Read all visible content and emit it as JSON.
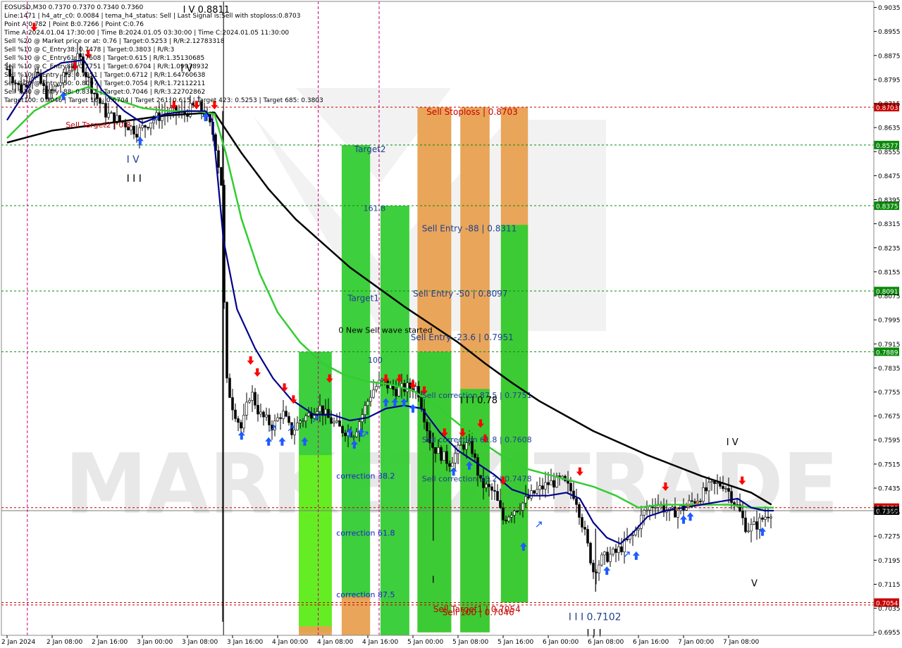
{
  "header": {
    "lines": [
      "EOSUSD,M30  0.7370 0.7370 0.7340 0.7360",
      "Line:1471  |  h4_atr_c0: 0.0084 |  tema_h4_status: Sell  |  Last Signal is:Sell with stoploss:0.8703",
      "Point A:0.782  |  Point B:0.7266  |  Point C:0.76",
      "Time A:2024.01.04 17:30:00  |  Time B:2024.01.05 03:30:00  |  Time C:2024.01.05 11:30:00",
      "Sell %20 @ Market price or at: 0.76  |  Target:0.5253  |  R/R:2.12783318",
      "Sell %10 @ C_Entry38: 0.7478  |  Target:0.3803  |  R/R:3",
      "Sell %10 @ C_Entry61: 0.7608  |  Target:0.615  |  R/R:1.35130685",
      "Sell %10 @ C_Entry88: 0.7751  |  Target:0.6704  |  R/R:1.09978932",
      "Sell %10 @ Entry -23: 0.7951  |  Target:0.6712  |  R/R:1.64760638",
      "Sell %20 @ Entry -50: 0.8097  |  Target:0.7054  |  R/R:1.72112211",
      "Sell %20 @ Entry -88: 0.8311  |  Target:0.7046  |  R/R:3.22702862",
      "Target100: 0.7046  |  Target 161: 0.6704  |  Target 261: 0.615  |  Target 423: 0.5253  |  Target 685: 0.3803"
    ]
  },
  "watermark": "MARKETZITRADE",
  "colors": {
    "background": "#ffffff",
    "bull_candle": "#000000",
    "bear_candle": "#000000",
    "ma_fast": "#00008b",
    "ma_mid": "#32cd32",
    "ma_slow": "#000000",
    "level_green": "#0a8a0a",
    "level_red": "#c80000",
    "price_line": "#d00000",
    "zone_green": "#33cc33",
    "zone_lime": "#66ee22",
    "zone_orange": "#e8a050",
    "arrow_red": "#ff0000",
    "arrow_blue": "#1e5aff",
    "vline_magenta": "#cc0077"
  },
  "chart_data": {
    "type": "candlestick",
    "symbol": "EOSUSD",
    "timeframe": "M30",
    "ohlc_last": {
      "open": 0.737,
      "high": 0.737,
      "low": 0.734,
      "close": 0.736
    },
    "ylim": [
      0.6945,
      0.9055
    ],
    "yticks": [
      "0.9035",
      "0.8955",
      "0.8875",
      "0.8795",
      "0.8715",
      "0.8635",
      "0.8555",
      "0.8475",
      "0.8395",
      "0.8315",
      "0.8235",
      "0.8155",
      "0.8075",
      "0.7995",
      "0.7915",
      "0.7835",
      "0.7755",
      "0.7675",
      "0.7595",
      "0.7515",
      "0.7435",
      "0.7355",
      "0.7275",
      "0.7195",
      "0.7115",
      "0.7035",
      "0.6955"
    ],
    "xticks": [
      "2 Jan 2024",
      "2 Jan 08:00",
      "2 Jan 16:00",
      "3 Jan 00:00",
      "3 Jan 08:00",
      "3 Jan 16:00",
      "4 Jan 00:00",
      "4 Jan 08:00",
      "4 Jan 16:00",
      "5 Jan 00:00",
      "5 Jan 08:00",
      "5 Jan 16:00",
      "6 Jan 00:00",
      "6 Jan 08:00",
      "6 Jan 16:00",
      "7 Jan 00:00",
      "7 Jan 08:00"
    ],
    "xmax_index": 17.1,
    "price_key_points": [
      [
        0,
        0.883
      ],
      [
        0.3,
        0.876
      ],
      [
        0.6,
        0.882
      ],
      [
        0.9,
        0.874
      ],
      [
        1.2,
        0.879
      ],
      [
        1.6,
        0.887
      ],
      [
        1.9,
        0.876
      ],
      [
        2.2,
        0.868
      ],
      [
        2.6,
        0.865
      ],
      [
        2.9,
        0.862
      ],
      [
        3.2,
        0.866
      ],
      [
        3.6,
        0.869
      ],
      [
        3.9,
        0.868
      ],
      [
        4.2,
        0.871
      ],
      [
        4.4,
        0.868
      ],
      [
        4.6,
        0.86
      ],
      [
        4.75,
        0.845
      ],
      [
        4.85,
        0.78
      ],
      [
        5.0,
        0.771
      ],
      [
        5.2,
        0.763
      ],
      [
        5.4,
        0.776
      ],
      [
        5.6,
        0.768
      ],
      [
        5.9,
        0.764
      ],
      [
        6.1,
        0.769
      ],
      [
        6.3,
        0.762
      ],
      [
        6.5,
        0.766
      ],
      [
        6.7,
        0.768
      ],
      [
        6.9,
        0.771
      ],
      [
        7.1,
        0.767
      ],
      [
        7.4,
        0.763
      ],
      [
        7.7,
        0.762
      ],
      [
        7.9,
        0.769
      ],
      [
        8.1,
        0.776
      ],
      [
        8.3,
        0.779
      ],
      [
        8.6,
        0.776
      ],
      [
        8.9,
        0.777
      ],
      [
        9.1,
        0.777
      ],
      [
        9.4,
        0.758
      ],
      [
        9.6,
        0.755
      ],
      [
        9.8,
        0.752
      ],
      [
        10.1,
        0.758
      ],
      [
        10.3,
        0.757
      ],
      [
        10.5,
        0.745
      ],
      [
        10.8,
        0.742
      ],
      [
        11.0,
        0.733
      ],
      [
        11.2,
        0.736
      ],
      [
        11.4,
        0.738
      ],
      [
        11.7,
        0.742
      ],
      [
        12.0,
        0.745
      ],
      [
        12.3,
        0.746
      ],
      [
        12.6,
        0.741
      ],
      [
        12.8,
        0.729
      ],
      [
        13.0,
        0.716
      ],
      [
        13.2,
        0.72
      ],
      [
        13.5,
        0.722
      ],
      [
        13.7,
        0.725
      ],
      [
        13.9,
        0.728
      ],
      [
        14.1,
        0.735
      ],
      [
        14.4,
        0.739
      ],
      [
        14.7,
        0.735
      ],
      [
        15.0,
        0.737
      ],
      [
        15.3,
        0.74
      ],
      [
        15.6,
        0.744
      ],
      [
        15.9,
        0.745
      ],
      [
        16.2,
        0.737
      ],
      [
        16.4,
        0.73
      ],
      [
        16.6,
        0.731
      ],
      [
        16.8,
        0.734
      ],
      [
        16.95,
        0.736
      ]
    ],
    "ma_fast": [
      [
        0,
        0.866
      ],
      [
        0.6,
        0.88
      ],
      [
        1.2,
        0.885
      ],
      [
        1.7,
        0.886
      ],
      [
        2.1,
        0.876
      ],
      [
        2.6,
        0.869
      ],
      [
        3.0,
        0.865
      ],
      [
        3.5,
        0.868
      ],
      [
        4.0,
        0.869
      ],
      [
        4.4,
        0.869
      ],
      [
        4.55,
        0.866
      ],
      [
        4.8,
        0.826
      ],
      [
        5.1,
        0.803
      ],
      [
        5.5,
        0.79
      ],
      [
        5.9,
        0.78
      ],
      [
        6.3,
        0.773
      ],
      [
        6.8,
        0.768
      ],
      [
        7.2,
        0.768
      ],
      [
        7.6,
        0.766
      ],
      [
        8.0,
        0.767
      ],
      [
        8.4,
        0.77
      ],
      [
        8.8,
        0.771
      ],
      [
        9.2,
        0.77
      ],
      [
        9.6,
        0.762
      ],
      [
        10.0,
        0.756
      ],
      [
        10.4,
        0.752
      ],
      [
        10.8,
        0.748
      ],
      [
        11.2,
        0.743
      ],
      [
        11.6,
        0.741
      ],
      [
        12.0,
        0.741
      ],
      [
        12.4,
        0.742
      ],
      [
        12.7,
        0.74
      ],
      [
        13.0,
        0.732
      ],
      [
        13.3,
        0.727
      ],
      [
        13.6,
        0.725
      ],
      [
        13.9,
        0.729
      ],
      [
        14.2,
        0.734
      ],
      [
        14.6,
        0.736
      ],
      [
        15.0,
        0.737
      ],
      [
        15.4,
        0.738
      ],
      [
        15.8,
        0.739
      ],
      [
        16.2,
        0.74
      ],
      [
        16.5,
        0.737
      ],
      [
        16.8,
        0.736
      ],
      [
        17.0,
        0.736
      ]
    ],
    "ma_mid": [
      [
        0,
        0.86
      ],
      [
        0.6,
        0.869
      ],
      [
        1.2,
        0.874
      ],
      [
        1.8,
        0.877
      ],
      [
        2.4,
        0.873
      ],
      [
        3.0,
        0.87
      ],
      [
        3.6,
        0.869
      ],
      [
        4.2,
        0.869
      ],
      [
        4.6,
        0.868
      ],
      [
        4.85,
        0.855
      ],
      [
        5.2,
        0.833
      ],
      [
        5.6,
        0.815
      ],
      [
        6.0,
        0.802
      ],
      [
        6.5,
        0.792
      ],
      [
        7.0,
        0.785
      ],
      [
        7.5,
        0.781
      ],
      [
        8.0,
        0.779
      ],
      [
        8.5,
        0.778
      ],
      [
        9.0,
        0.776
      ],
      [
        9.5,
        0.771
      ],
      [
        10.0,
        0.765
      ],
      [
        10.5,
        0.759
      ],
      [
        11.0,
        0.754
      ],
      [
        11.5,
        0.75
      ],
      [
        12.0,
        0.748
      ],
      [
        12.5,
        0.746
      ],
      [
        13.0,
        0.744
      ],
      [
        13.5,
        0.741
      ],
      [
        14.0,
        0.737
      ],
      [
        14.5,
        0.738
      ],
      [
        15.0,
        0.738
      ],
      [
        15.5,
        0.738
      ],
      [
        16.0,
        0.738
      ],
      [
        16.5,
        0.737
      ],
      [
        17.0,
        0.737
      ]
    ],
    "ma_slow": [
      [
        0,
        0.8585
      ],
      [
        0.5,
        0.8605
      ],
      [
        1.0,
        0.8625
      ],
      [
        1.5,
        0.8635
      ],
      [
        2.0,
        0.8645
      ],
      [
        2.5,
        0.8655
      ],
      [
        3.0,
        0.8665
      ],
      [
        3.5,
        0.8675
      ],
      [
        4.0,
        0.868
      ],
      [
        4.6,
        0.8685
      ],
      [
        5.2,
        0.855
      ],
      [
        5.8,
        0.843
      ],
      [
        6.4,
        0.833
      ],
      [
        7.0,
        0.825
      ],
      [
        7.6,
        0.817
      ],
      [
        8.2,
        0.8105
      ],
      [
        8.8,
        0.804
      ],
      [
        9.4,
        0.798
      ],
      [
        10.0,
        0.792
      ],
      [
        10.6,
        0.785
      ],
      [
        11.2,
        0.7785
      ],
      [
        11.8,
        0.7725
      ],
      [
        12.4,
        0.7675
      ],
      [
        13.0,
        0.7625
      ],
      [
        13.6,
        0.7585
      ],
      [
        14.2,
        0.7545
      ],
      [
        14.8,
        0.751
      ],
      [
        15.4,
        0.7475
      ],
      [
        16.0,
        0.7445
      ],
      [
        16.5,
        0.742
      ],
      [
        16.95,
        0.738
      ]
    ],
    "current_price": 0.736,
    "levels": [
      {
        "price": 0.8703,
        "label": "0.8703",
        "color": "#c80000",
        "text": "Sell Stoploss | 0.8703"
      },
      {
        "price": 0.8577,
        "label": "0.8577",
        "color": "#0a8a0a"
      },
      {
        "price": 0.8375,
        "label": "0.8375",
        "color": "#0a8a0a"
      },
      {
        "price": 0.8091,
        "label": "0.8091",
        "color": "#0a8a0a"
      },
      {
        "price": 0.7889,
        "label": "0.7889",
        "color": "#0a8a0a"
      },
      {
        "price": 0.737,
        "label": "0.7370",
        "color": "#c80000"
      },
      {
        "price": 0.7054,
        "label": "0.7054",
        "color": "#c80000"
      }
    ],
    "zones": [
      {
        "x0": 6.47,
        "x1": 7.2,
        "y0": 0.6955,
        "y1": 0.7889,
        "color": "green"
      },
      {
        "x0": 6.47,
        "x1": 7.2,
        "y0": 0.6955,
        "y1": 0.7545,
        "color": "lime"
      },
      {
        "x0": 6.47,
        "x1": 7.2,
        "y0": 0.6945,
        "y1": 0.6975,
        "color": "orange"
      },
      {
        "x0": 7.42,
        "x1": 8.05,
        "y0": 0.7065,
        "y1": 0.8577,
        "color": "green"
      },
      {
        "x0": 7.42,
        "x1": 8.05,
        "y0": 0.6945,
        "y1": 0.7075,
        "color": "orange"
      },
      {
        "x0": 8.28,
        "x1": 8.92,
        "y0": 0.6945,
        "y1": 0.8375,
        "color": "green"
      },
      {
        "x0": 9.1,
        "x1": 9.85,
        "y0": 0.6955,
        "y1": 0.8703,
        "color": "orange"
      },
      {
        "x0": 9.1,
        "x1": 9.85,
        "y0": 0.6955,
        "y1": 0.7889,
        "color": "green"
      },
      {
        "x0": 10.05,
        "x1": 10.7,
        "y0": 0.6955,
        "y1": 0.8703,
        "color": "orange"
      },
      {
        "x0": 10.05,
        "x1": 10.7,
        "y0": 0.6955,
        "y1": 0.7765,
        "color": "green"
      },
      {
        "x0": 10.95,
        "x1": 11.55,
        "y0": 0.7054,
        "y1": 0.8703,
        "color": "orange"
      },
      {
        "x0": 10.95,
        "x1": 11.55,
        "y0": 0.7054,
        "y1": 0.8311,
        "color": "green"
      }
    ],
    "vlines": [
      {
        "x": 0.45,
        "color": "magenta"
      },
      {
        "x": 6.9,
        "color": "magenta"
      },
      {
        "x": 8.25,
        "color": "magenta"
      },
      {
        "x": 4.8,
        "color": "black"
      }
    ],
    "annotations": [
      {
        "text": "Target2",
        "x": 7.7,
        "y": 0.8553,
        "color": "#1f3f8f",
        "size": 12
      },
      {
        "text": "161.8",
        "x": 7.9,
        "y": 0.8358,
        "color": "#1f3f8f",
        "size": 11
      },
      {
        "text": "Target1",
        "x": 7.55,
        "y": 0.8058,
        "color": "#1f3f8f",
        "size": 12
      },
      {
        "text": "0 New Sell wave started",
        "x": 7.35,
        "y": 0.7952,
        "color": "#000000",
        "size": 11
      },
      {
        "text": "100",
        "x": 8.0,
        "y": 0.7852,
        "color": "#1f3f8f",
        "size": 11
      },
      {
        "text": "Sell Stoploss | 0.8703",
        "x": 9.3,
        "y": 0.8678,
        "color": "#c80000",
        "size": 12
      },
      {
        "text": "Sell Entry -88 | 0.8311",
        "x": 9.2,
        "y": 0.829,
        "color": "#1f3f8f",
        "size": 12
      },
      {
        "text": "Sell Entry -50 | 0.8097",
        "x": 9.0,
        "y": 0.8073,
        "color": "#1f3f8f",
        "size": 12
      },
      {
        "text": "Sell Entry -23.6 | 0.7951",
        "x": 8.95,
        "y": 0.7927,
        "color": "#1f3f8f",
        "size": 12
      },
      {
        "text": "Sell correction 87.5 | 0.7751",
        "x": 9.2,
        "y": 0.7735,
        "color": "#1f3f8f",
        "size": 11
      },
      {
        "text": "Sell correction 61.8 | 0.7608",
        "x": 9.2,
        "y": 0.7587,
        "color": "#1f3f8f",
        "size": 11
      },
      {
        "text": "Sell correction 38.2 | 0.7478",
        "x": 9.2,
        "y": 0.7457,
        "color": "#1f3f8f",
        "size": 11
      },
      {
        "text": "correction 38.2",
        "x": 7.3,
        "y": 0.7467,
        "color": "#2020d0",
        "size": 11
      },
      {
        "text": "correction 61.8",
        "x": 7.3,
        "y": 0.7277,
        "color": "#2020d0",
        "size": 11
      },
      {
        "text": "correction 87.5",
        "x": 7.3,
        "y": 0.7072,
        "color": "#2020d0",
        "size": 11
      },
      {
        "text": "Sell Target1 | 0.7054",
        "x": 9.45,
        "y": 0.7022,
        "color": "#c80000",
        "size": 12
      },
      {
        "text": "Sell 100 | 0.7046",
        "x": 9.65,
        "y": 0.7012,
        "color": "#c80000",
        "size": 12
      },
      {
        "text": "I I I 0.7102",
        "x": 12.45,
        "y": 0.6995,
        "color": "#1f3f8f",
        "size": 14
      },
      {
        "text": "I I I",
        "x": 12.85,
        "y": 0.6942,
        "color": "#000000",
        "size": 14
      },
      {
        "text": "I V",
        "x": 2.65,
        "y": 0.8518,
        "color": "#1f3f8f",
        "size": 14
      },
      {
        "text": "I I I",
        "x": 2.65,
        "y": 0.8455,
        "color": "#000000",
        "size": 14
      },
      {
        "text": "I V",
        "x": 15.95,
        "y": 0.7578,
        "color": "#000000",
        "size": 13
      },
      {
        "text": "V",
        "x": 16.5,
        "y": 0.7108,
        "color": "#000000",
        "size": 13
      },
      {
        "text": "I I I 0.78",
        "x": 10.05,
        "y": 0.7718,
        "color": "#000000",
        "size": 13
      },
      {
        "text": "I",
        "x": 9.42,
        "y": 0.712,
        "color": "#000000",
        "size": 13
      },
      {
        "text": "Sell Target2 | 0.8",
        "x": 1.3,
        "y": 0.8635,
        "color": "#c80000",
        "size": 11
      },
      {
        "text": "I V 0.8811",
        "x": 3.9,
        "y": 0.9018,
        "color": "#000000",
        "size": 13
      },
      {
        "text": "I V",
        "x": 3.85,
        "y": 0.8822,
        "color": "#000000",
        "size": 13
      }
    ],
    "red_arrows": [
      [
        0.6,
        0.8965
      ],
      [
        1.5,
        0.8835
      ],
      [
        1.8,
        0.8875
      ],
      [
        3.7,
        0.8705
      ],
      [
        4.2,
        0.8705
      ],
      [
        4.6,
        0.8705
      ],
      [
        5.4,
        0.7855
      ],
      [
        5.55,
        0.7815
      ],
      [
        6.15,
        0.7765
      ],
      [
        6.35,
        0.7725
      ],
      [
        7.15,
        0.7795
      ],
      [
        8.4,
        0.7795
      ],
      [
        8.7,
        0.7795
      ],
      [
        9.0,
        0.7775
      ],
      [
        9.25,
        0.7755
      ],
      [
        9.7,
        0.7615
      ],
      [
        10.1,
        0.7615
      ],
      [
        10.5,
        0.7645
      ],
      [
        10.6,
        0.7595
      ],
      [
        11.0,
        0.7455
      ],
      [
        12.7,
        0.7485
      ],
      [
        14.6,
        0.7435
      ],
      [
        16.3,
        0.7455
      ]
    ],
    "blue_arrows": [
      [
        1.25,
        0.8745
      ],
      [
        2.95,
        0.8595
      ],
      [
        4.4,
        0.8675
      ],
      [
        5.2,
        0.7615
      ],
      [
        5.8,
        0.7595
      ],
      [
        6.1,
        0.7595
      ],
      [
        6.6,
        0.7595
      ],
      [
        7.6,
        0.7625
      ],
      [
        7.7,
        0.7585
      ],
      [
        7.85,
        0.7625
      ],
      [
        8.4,
        0.7725
      ],
      [
        8.6,
        0.7725
      ],
      [
        8.8,
        0.7725
      ],
      [
        9.0,
        0.7705
      ],
      [
        9.9,
        0.7495
      ],
      [
        10.25,
        0.7515
      ],
      [
        11.45,
        0.7245
      ],
      [
        13.3,
        0.7165
      ],
      [
        13.95,
        0.7215
      ],
      [
        15.0,
        0.7335
      ],
      [
        15.15,
        0.7345
      ],
      [
        16.75,
        0.7295
      ]
    ],
    "open_arrows": [
      [
        3.3,
        0.8665
      ],
      [
        5.9,
        0.7635
      ],
      [
        6.3,
        0.7635
      ],
      [
        6.85,
        0.7665
      ],
      [
        7.95,
        0.7615
      ],
      [
        11.8,
        0.7315
      ],
      [
        13.75,
        0.7215
      ]
    ],
    "small_markers": [
      [
        14.85,
        0.7365
      ],
      [
        15.1,
        0.7375
      ],
      [
        15.3,
        0.7385
      ]
    ]
  }
}
